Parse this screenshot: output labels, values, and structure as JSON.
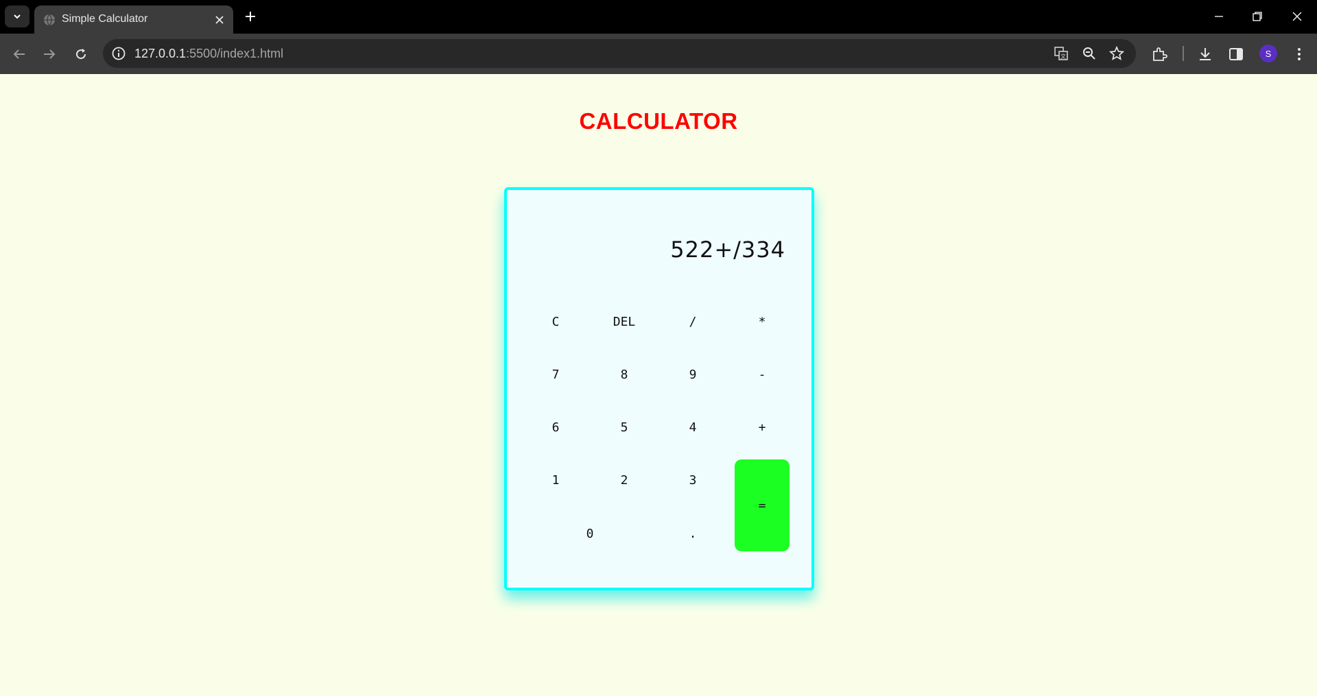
{
  "browser": {
    "tab_title": "Simple Calculator",
    "url_host": "127.0.0.1",
    "url_rest": ":5500/index1.html",
    "profile_initial": "S"
  },
  "page": {
    "title": "CALCULATOR"
  },
  "calculator": {
    "display": "522+/334",
    "keys": {
      "clear": "C",
      "del": "DEL",
      "divide": "/",
      "multiply": "*",
      "seven": "7",
      "eight": "8",
      "nine": "9",
      "minus": "-",
      "six": "6",
      "five": "5",
      "four": "4",
      "plus": "+",
      "one": "1",
      "two": "2",
      "three": "3",
      "equals": "=",
      "zero": "0",
      "dot": "."
    },
    "colors": {
      "equals_bg": "#1bff22",
      "border": "#00ffff",
      "title": "#ff0000"
    }
  }
}
